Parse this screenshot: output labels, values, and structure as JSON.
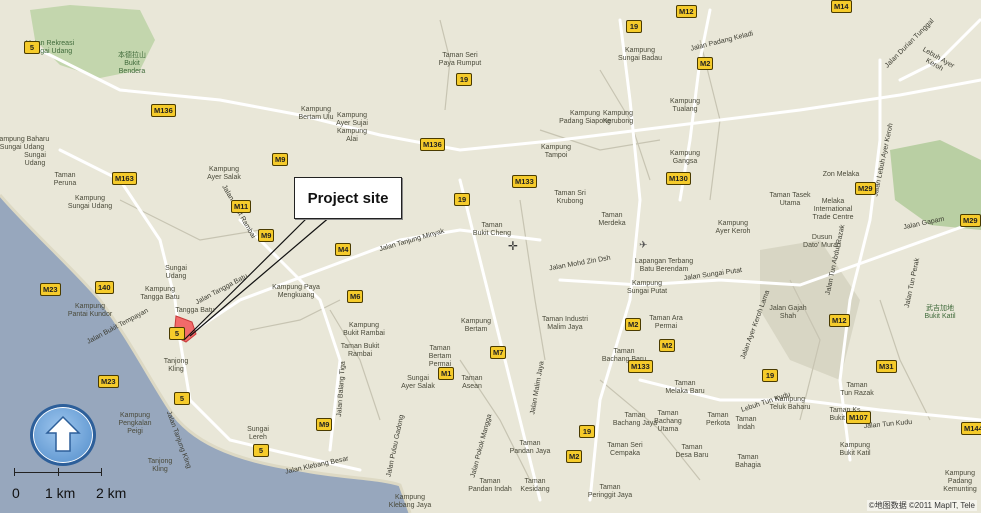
{
  "callout": {
    "text": "Project site"
  },
  "credit": "©地图数据 ©2011 MapIT, Tele",
  "scale_bar": {
    "labels": [
      "0",
      "1 km",
      "2 km"
    ]
  },
  "colors": {
    "land": "#e9e7d8",
    "sea": "#97a7bd",
    "park": "#b9cfa3",
    "major_road": "#ffffff",
    "shield": "#f5cb2b",
    "marker": "#f26a6a"
  },
  "labels": [
    {
      "text": "Hutan Rekreasi\nSungai Udang",
      "kind": "green"
    },
    {
      "text": "本德拉山\nBukit\nBendera",
      "kind": "green"
    },
    {
      "text": "Kampung Baharu\nSungai Udang",
      "kind": "place"
    },
    {
      "text": "Sungai\nUdang",
      "kind": "place"
    },
    {
      "text": "Taman\nPeruna",
      "kind": "place"
    },
    {
      "text": "Kampung\nSungai Udang",
      "kind": "place"
    },
    {
      "text": "Kampung\nBertam Ulu",
      "kind": "place"
    },
    {
      "text": "Kampung\nAyer Sujai",
      "kind": "place"
    },
    {
      "text": "Kampung\nAlai",
      "kind": "place"
    },
    {
      "text": "Kampung\nAyer Salak",
      "kind": "place"
    },
    {
      "text": "Sungai\nUdang",
      "kind": "place"
    },
    {
      "text": "Kampung\nTangga Batu",
      "kind": "place"
    },
    {
      "text": "Tangga Batu",
      "kind": "place"
    },
    {
      "text": "Kampung\nPantai Kundor",
      "kind": "place"
    },
    {
      "text": "Tanjong\nKling",
      "kind": "place"
    },
    {
      "text": "Kampung\nPengkalan\nPeigi",
      "kind": "place"
    },
    {
      "text": "Tanjong\nKling",
      "kind": "place"
    },
    {
      "text": "Sungai\nLereh",
      "kind": "place"
    },
    {
      "text": "Kampung Paya\nMengkuang",
      "kind": "place"
    },
    {
      "text": "Kampung\nBukit Rambai",
      "kind": "place"
    },
    {
      "text": "Taman Bukit\nRambai",
      "kind": "place"
    },
    {
      "text": "Sungai\nAyer Salak",
      "kind": "place"
    },
    {
      "text": "Taman\nAsean",
      "kind": "place"
    },
    {
      "text": "Taman\nBertam\nPermai",
      "kind": "place"
    },
    {
      "text": "Kampung\nBertam",
      "kind": "place"
    },
    {
      "text": "Taman Seri\nPaya Rumput",
      "kind": "place"
    },
    {
      "text": "Kampung\nSungai Badau",
      "kind": "place"
    },
    {
      "text": "Kampung\nKerubong",
      "kind": "place"
    },
    {
      "text": "Kampung\nPadang Siapong",
      "kind": "place"
    },
    {
      "text": "Kampung\nTampoi",
      "kind": "place"
    },
    {
      "text": "Kampung\nTualang",
      "kind": "place"
    },
    {
      "text": "Kampung\nGangsa",
      "kind": "place"
    },
    {
      "text": "Taman Sri\nKrubong",
      "kind": "place"
    },
    {
      "text": "Taman\nBukit Cheng",
      "kind": "place"
    },
    {
      "text": "Taman\nMerdeka",
      "kind": "place"
    },
    {
      "text": "Lapangan Terbang\nBatu Berendam",
      "kind": "place"
    },
    {
      "text": "Kampung\nSungai Putat",
      "kind": "place"
    },
    {
      "text": "Taman Industri\nMalim Jaya",
      "kind": "place"
    },
    {
      "text": "Taman Ara\nPermai",
      "kind": "place"
    },
    {
      "text": "Taman\nBachang Baru",
      "kind": "place"
    },
    {
      "text": "Taman\nMelaka Baru",
      "kind": "place"
    },
    {
      "text": "Taman\nBachang Jaya",
      "kind": "place"
    },
    {
      "text": "Taman\nBachang\nUtama",
      "kind": "place"
    },
    {
      "text": "Taman\nPerkota",
      "kind": "place"
    },
    {
      "text": "Taman\nIndah",
      "kind": "place"
    },
    {
      "text": "Taman\nDesa Baru",
      "kind": "place"
    },
    {
      "text": "Taman\nBahagia",
      "kind": "place"
    },
    {
      "text": "Taman Seri\nCempaka",
      "kind": "place"
    },
    {
      "text": "Taman\nPandan Jaya",
      "kind": "place"
    },
    {
      "text": "Taman\nPandan Indah",
      "kind": "place"
    },
    {
      "text": "Taman\nKesidang",
      "kind": "place"
    },
    {
      "text": "Taman\nPeringgit Jaya",
      "kind": "place"
    },
    {
      "text": "Kampung\nKlebang Jaya",
      "kind": "place"
    },
    {
      "text": "Taman Tasek\nUtama",
      "kind": "place"
    },
    {
      "text": "Zon Melaka",
      "kind": "place"
    },
    {
      "text": "Melaka\nInternational\nTrade Centre",
      "kind": "place"
    },
    {
      "text": "Kampung\nAyer Keroh",
      "kind": "place"
    },
    {
      "text": "Dusun\nDato' Murad",
      "kind": "place"
    },
    {
      "text": "Jalan Gajah\nShah",
      "kind": "place"
    },
    {
      "text": "Kampung\nTeluk Baharu",
      "kind": "place"
    },
    {
      "text": "Taman\nTun Razak",
      "kind": "place"
    },
    {
      "text": "Taman Ks\nBukit Katil",
      "kind": "place"
    },
    {
      "text": "Kampung\nBukit Katil",
      "kind": "place"
    },
    {
      "text": "武吉加地\nBukit Katil",
      "kind": "green"
    },
    {
      "text": "Kampung\nPadang Kemunting",
      "kind": "place"
    }
  ],
  "road_labels": [
    "Jalan Tangga Batu",
    "Jalan Bukit Rambai",
    "Jalan Tanjung Minyak",
    "Jalan Klebang Besar",
    "Jalan Tanjung Kling",
    "Jalan Bukit Tempayan",
    "Jalan Balang Tiga",
    "Jalan Pulau Gadong",
    "Jalan Pokok Mangga",
    "Jalan Malim Jaya",
    "Jalan Mohd Zin Dsh",
    "Jalan Sungai Putat",
    "Jalan Lebuh Ayer Keroh",
    "Jalan Tun Kudu",
    "Jalan Gapam",
    "Jalan Padang Keladi",
    "Jalan Durian Tunggal",
    "Lebuh Ayer Keroh",
    "Jalan Tun Abdul Razak",
    "Jalan Tun Perak",
    "Lebuh Tun Kudu",
    "Jalan Ayer Keroh Lama"
  ],
  "shields": [
    "5",
    "M136",
    "M9",
    "M163",
    "M11",
    "M9",
    "M4",
    "M6",
    "M23",
    "140",
    "5",
    "M23",
    "5",
    "5",
    "M9",
    "19",
    "M133",
    "19",
    "M136",
    "19",
    "M133",
    "M2",
    "M130",
    "M2",
    "M2",
    "M1",
    "M7",
    "19",
    "M2",
    "19",
    "M29",
    "M29",
    "M12",
    "M31",
    "M107",
    "M144",
    "M14",
    "M12"
  ]
}
